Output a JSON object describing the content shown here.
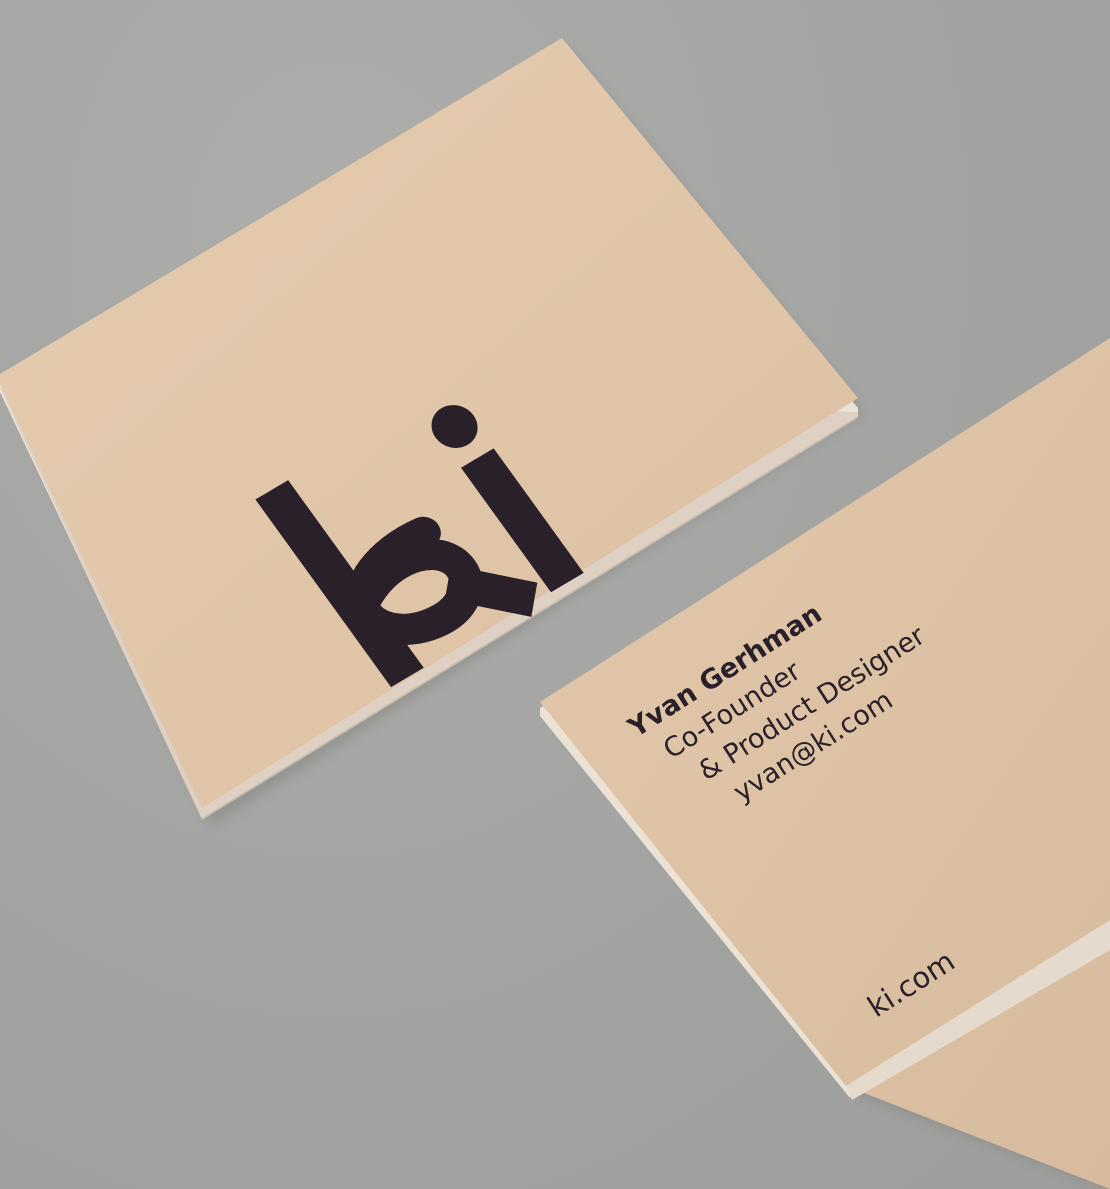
{
  "colors": {
    "surface": "#a4a4a2",
    "card": "#e2c7ab",
    "ink": "#2a2029"
  },
  "front_card": {
    "logo_text": "ki"
  },
  "back_card": {
    "name": "Yvan Gerhman",
    "title_line_1": "Co-Founder",
    "title_line_2": "& Product Designer",
    "email": "yvan@ki.com",
    "website": "ki.com"
  }
}
